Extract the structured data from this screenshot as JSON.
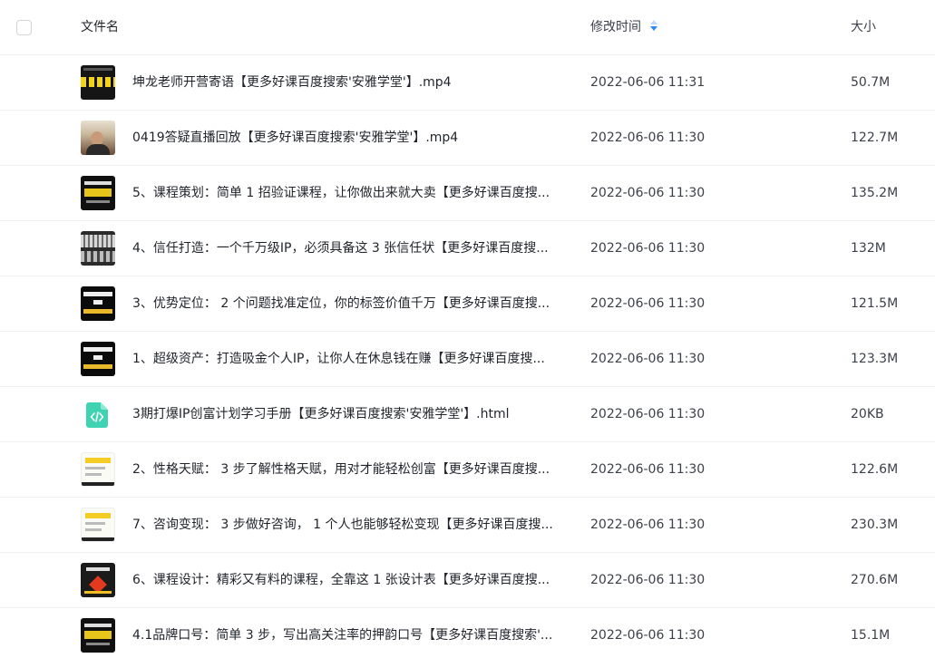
{
  "header": {
    "col_name": "文件名",
    "col_time": "修改时间",
    "col_size": "大小"
  },
  "accent_color": "#2b8af7",
  "rows": [
    {
      "name": "坤龙老师开营寄语【更多好课百度搜索'安雅学堂'】.mp4",
      "time": "2022-06-06 11:31",
      "size": "50.7M",
      "thumb": "video"
    },
    {
      "name": "0419答疑直播回放【更多好课百度搜索'安雅学堂'】.mp4",
      "time": "2022-06-06 11:30",
      "size": "122.7M",
      "thumb": "photo"
    },
    {
      "name": "5、课程策划：简单 1 招验证课程，让你做出来就大卖【更多好课百度搜...",
      "time": "2022-06-06 11:30",
      "size": "135.2M",
      "thumb": "slide"
    },
    {
      "name": "4、信任打造：一个千万级IP，必须具备这 3 张信任状【更多好课百度搜...",
      "time": "2022-06-06 11:30",
      "size": "132M",
      "thumb": "board"
    },
    {
      "name": "3、优势定位： 2 个问题找准定位，你的标签价值千万【更多好课百度搜...",
      "time": "2022-06-06 11:30",
      "size": "121.5M",
      "thumb": "text"
    },
    {
      "name": "1、超级资产：打造吸金个人IP，让你人在休息钱在赚【更多好课百度搜...",
      "time": "2022-06-06 11:30",
      "size": "123.3M",
      "thumb": "text"
    },
    {
      "name": "3期打爆IP创富计划学习手册【更多好课百度搜索'安雅学堂'】.html",
      "time": "2022-06-06 11:30",
      "size": "20KB",
      "thumb": "html"
    },
    {
      "name": "2、性格天赋： 3 步了解性格天赋，用对才能轻松创富【更多好课百度搜...",
      "time": "2022-06-06 11:30",
      "size": "122.6M",
      "thumb": "light"
    },
    {
      "name": "7、咨询变现： 3 步做好咨询， 1 个人也能够轻松变现【更多好课百度搜...",
      "time": "2022-06-06 11:30",
      "size": "230.3M",
      "thumb": "light"
    },
    {
      "name": "6、课程设计：精彩又有料的课程，全靠这 1 张设计表【更多好课百度搜...",
      "time": "2022-06-06 11:30",
      "size": "270.6M",
      "thumb": "dark2"
    },
    {
      "name": "4.1品牌口号：简单 3 步，写出高关注率的押韵口号【更多好课百度搜索'...",
      "time": "2022-06-06 11:30",
      "size": "15.1M",
      "thumb": "slide"
    }
  ]
}
